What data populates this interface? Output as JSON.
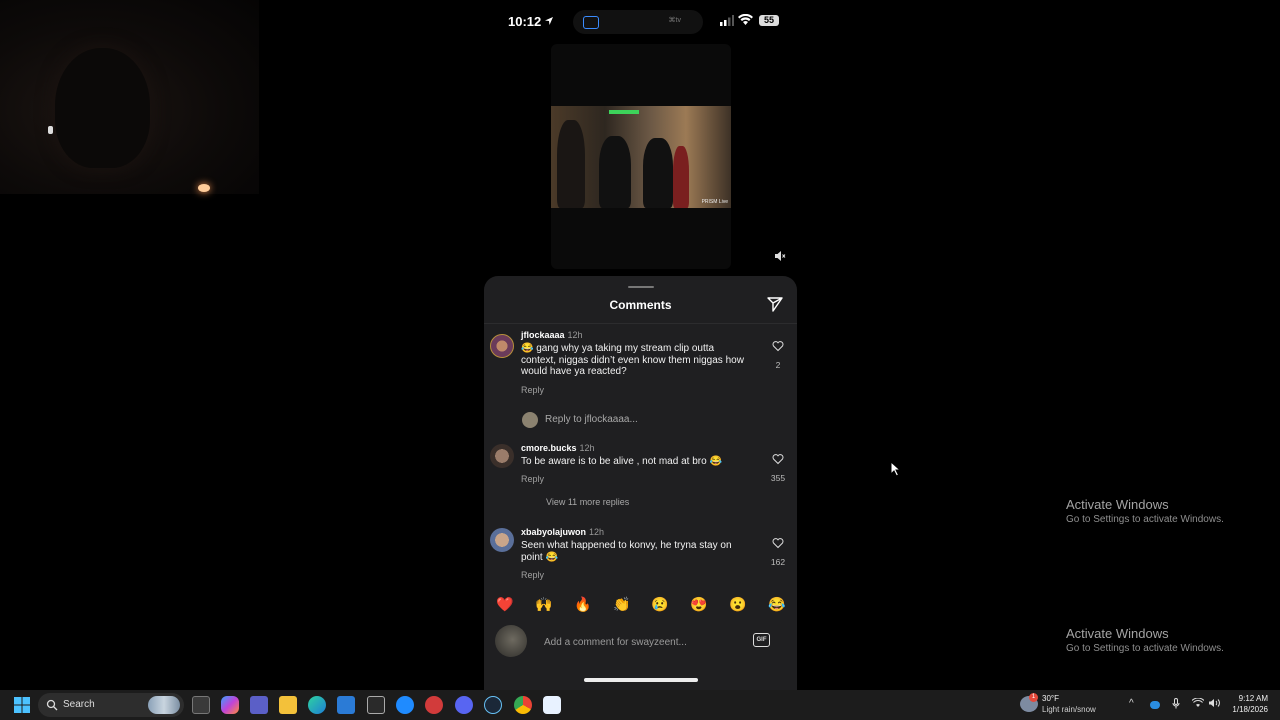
{
  "phone": {
    "status": {
      "time": "10:12",
      "battery": "55",
      "tv_label": "⌘tv"
    },
    "video": {
      "watermark": "PRISM Live"
    },
    "sheet": {
      "title": "Comments"
    },
    "comments": [
      {
        "user": "jflockaaaa",
        "ago": "12h",
        "text": "😂 gang why ya taking my stream clip outta context, niggas didn’t even know them niggas how would have ya reacted?",
        "reply": "Reply",
        "likes": "2",
        "avatar_color": "#6a3b5a"
      },
      {
        "user": "cmore.bucks",
        "ago": "12h",
        "text": "To be aware is to be alive , not mad at bro 😂",
        "reply": "Reply",
        "likes": "355",
        "avatar_color": "#5a4a40"
      },
      {
        "user": "xbabyolajuwon",
        "ago": "12h",
        "text": "Seen what happened to konvy, he tryna stay on point 😂",
        "reply": "Reply",
        "likes": "162",
        "avatar_color": "#5a6f9a"
      }
    ],
    "reply_prompt": "Reply to jflockaaaa...",
    "view_more": "View 11 more replies",
    "emojis": [
      "❤️",
      "🙌",
      "🔥",
      "👏",
      "😢",
      "😍",
      "😮",
      "😂"
    ],
    "input": {
      "placeholder": "Add a comment for swayzeent..."
    },
    "gif_label": "GIF"
  },
  "watermarks": [
    {
      "title": "Activate Windows",
      "subtitle": "Go to Settings to activate Windows."
    },
    {
      "title": "Activate Windows",
      "subtitle": "Go to Settings to activate Windows."
    }
  ],
  "taskbar": {
    "search_label": "Search",
    "weather": {
      "temp": "30°F",
      "condition": "Light rain/snow",
      "badge": "1"
    },
    "clock": {
      "time": "9:12 AM",
      "date": "1/18/2026"
    },
    "apps": [
      "task-view",
      "copilot",
      "teams",
      "file-explorer",
      "edge",
      "store",
      "epic-games",
      "bluesky",
      "app-red",
      "discord",
      "steam",
      "chrome",
      "active-app"
    ]
  }
}
